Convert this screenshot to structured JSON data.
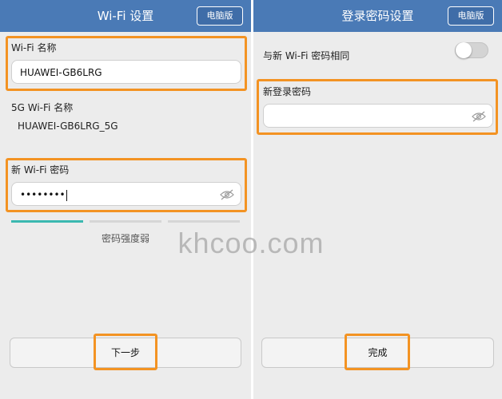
{
  "left_screen": {
    "title": "Wi-Fi 设置",
    "pc_mode_label": "电脑版",
    "wifi_name_label": "Wi-Fi 名称",
    "wifi_name_value": "HUAWEI-GB6LRG",
    "wifi_5g_name_label": "5G Wi-Fi 名称",
    "wifi_5g_name_value": "HUAWEI-GB6LRG_5G",
    "new_wifi_password_label": "新 Wi-Fi 密码",
    "new_wifi_password_value": "••••••••",
    "password_strength_label": "密码强度弱",
    "password_strength_level": "1/3",
    "next_button_label": "下一步"
  },
  "right_screen": {
    "title": "登录密码设置",
    "pc_mode_label": "电脑版",
    "same_as_wifi_label": "与新 Wi-Fi 密码相同",
    "same_as_wifi_toggle": "off",
    "new_login_password_label": "新登录密码",
    "new_login_password_value": "",
    "done_button_label": "完成"
  },
  "watermark": "khcoo.com",
  "colors": {
    "header": "#4a7ab6",
    "highlight": "#f39323",
    "strength_bar": "#3bb8b0",
    "background": "#ececec"
  },
  "icons": [
    "eye-hidden-icon",
    "toggle-switch"
  ]
}
